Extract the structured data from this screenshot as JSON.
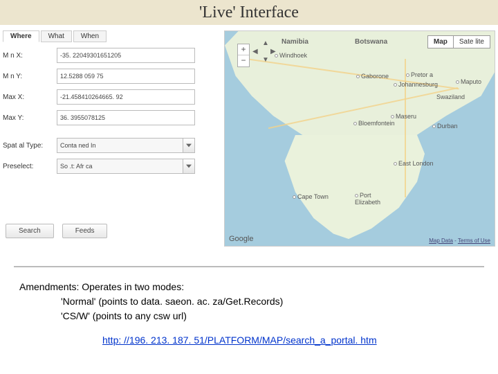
{
  "title": "'Live' Interface",
  "tabs": {
    "where": "Where",
    "what": "What",
    "when": "When"
  },
  "labels": {
    "minx": "M n X:",
    "miny": "M n Y:",
    "maxx": "Max X:",
    "maxy": "Max Y:",
    "spatial": "Spat al Type:",
    "preselect": "Preselect:"
  },
  "fields": {
    "minx": "-35. 22049301651205",
    "miny": "12.5288 059 75",
    "maxx": "-21.458410264665. 92",
    "maxy": "36. 3955078125",
    "spatial": "Conta ned In",
    "preselect": "So .t: Afr ca"
  },
  "buttons": {
    "search": "Search",
    "feeds": "Feeds"
  },
  "map": {
    "zoom_in": "+",
    "zoom_out": "−",
    "type_map": "Map",
    "type_sat": "Sate lite",
    "countries": {
      "namibia": "Namibia",
      "botswana": "Botswana"
    },
    "cities": {
      "windhoek": "Windhoek",
      "gaborone": "Gaborone",
      "pretoria": "Pretor a",
      "johannesburg": "Johannesburg",
      "maputo": "Maputo",
      "maseru": "Maseru",
      "bloemfontein": "Bloemfontein",
      "swaziland": "Swaziland",
      "durban": "Durban",
      "eastlondon": "East London",
      "capetown": "Cape Town",
      "portelizabeth": "Port\nElizabeth"
    },
    "logo": "Google",
    "credits_data": "Map Data",
    "credits_terms": "Terms of Use"
  },
  "amend": {
    "line1": "Amendments: Operates in two modes:",
    "line2": "'Normal' (points to data. saeon. ac. za/Get.Records)",
    "line3": "'CS/W' (points to any csw url)"
  },
  "url": "http: //196. 213. 187. 51/PLATFORM/MAP/search_a_portal. htm"
}
